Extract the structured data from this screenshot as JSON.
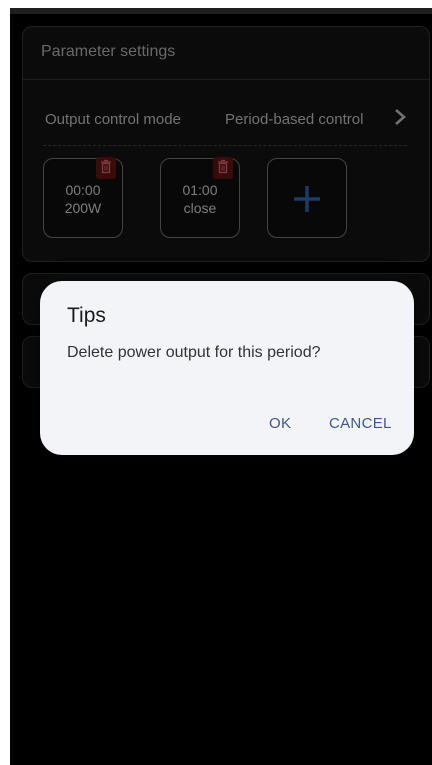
{
  "panel": {
    "title": "Parameter settings",
    "output_control": {
      "label": "Output control mode",
      "value": "Period-based control",
      "chevron_icon": "chevron-right-icon"
    },
    "periods": [
      {
        "time": "00:00",
        "value": "200W",
        "delete_icon": "trash-icon"
      },
      {
        "time": "01:00",
        "value": "close",
        "delete_icon": "trash-icon"
      }
    ],
    "add_icon": "plus-icon"
  },
  "dialog": {
    "title": "Tips",
    "message": "Delete power output for this period?",
    "ok_label": "OK",
    "cancel_label": "CANCEL"
  },
  "colors": {
    "background": "#000000",
    "panel_border": "#3b3b3b",
    "delete_badge": "#6b1515",
    "add_plus": "#2f6fb4",
    "dialog_background": "#f2f4f8",
    "dialog_button": "#3f5a88"
  }
}
